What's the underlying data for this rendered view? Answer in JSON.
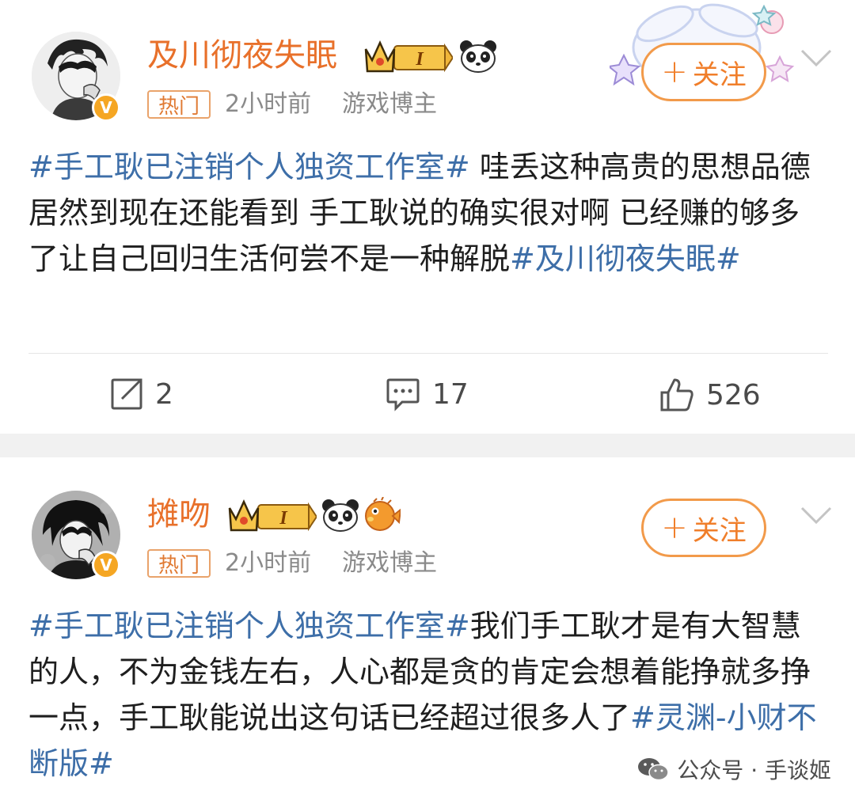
{
  "posts": [
    {
      "username": "及川彻夜失眠",
      "level": "I",
      "tag": "热门",
      "time": "2小时前",
      "role": "游戏博主",
      "verified_badge": "V",
      "follow_label": "关注",
      "content_parts": [
        {
          "text": "#手工耿已注销个人独资工作室#",
          "topic": true
        },
        {
          "text": " 哇丢这种高贵的思想品德居然到现在还能看到 手工耿说的确实很对啊 已经赚的够多了让自己回归生活何尝不是一种解脱",
          "topic": false
        },
        {
          "text": "#及川彻夜失眠#",
          "topic": true
        }
      ],
      "repost_count": "2",
      "comment_count": "17",
      "like_count": "526"
    },
    {
      "username": "摊吻",
      "level": "I",
      "tag": "热门",
      "time": "2小时前",
      "role": "游戏博主",
      "verified_badge": "V",
      "follow_label": "关注",
      "content_parts": [
        {
          "text": "#手工耿已注销个人独资工作室#",
          "topic": true
        },
        {
          "text": "我们手工耿才是有大智慧的人，不为金钱左右，人心都是贪的肯定会想着能挣就多挣一点，手工耿能说出这句话已经超过很多人了",
          "topic": false
        },
        {
          "text": "#灵渊-小财不断版#",
          "topic": true
        }
      ]
    }
  ],
  "watermark": {
    "text": "公众号 · 手谈姬"
  },
  "colors": {
    "username": "#e8702a",
    "topic": "#3d6ea8",
    "follow": "#f07e2a",
    "meta": "#8a8a8a"
  }
}
